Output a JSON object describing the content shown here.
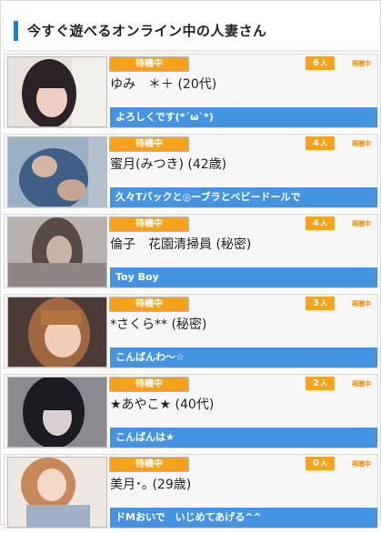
{
  "header": {
    "title": "今すぐ遊べるオンライン中の人妻さん",
    "accent": "#1f7fd6"
  },
  "colors": {
    "status_bg": "#f7a21b",
    "message_bg": "#4593e3",
    "viewing_text": "#f08a00"
  },
  "members": [
    {
      "status": "待機中",
      "count": "6",
      "count_unit": "人",
      "viewing_label": "視聴中",
      "name": "ゆみ　＊＋ (20代)",
      "message": "よろしくです(*´ω`*)"
    },
    {
      "status": "待機中",
      "count": "4",
      "count_unit": "人",
      "viewing_label": "視聴中",
      "name": "蜜月(みつき) (42歳)",
      "message": "久々Tバックと◎ーブラとベビードールで"
    },
    {
      "status": "待機中",
      "count": "4",
      "count_unit": "人",
      "viewing_label": "視聴中",
      "name": "倫子　花園清掃員 (秘密)",
      "message": "Toy Boy"
    },
    {
      "status": "待機中",
      "count": "3",
      "count_unit": "人",
      "viewing_label": "視聴中",
      "name": "*さくら** (秘密)",
      "message": "こんばんわ～☆"
    },
    {
      "status": "待機中",
      "count": "2",
      "count_unit": "人",
      "viewing_label": "視聴中",
      "name": "★あやこ★ (40代)",
      "message": "こんばんは★"
    },
    {
      "status": "待機中",
      "count": "0",
      "count_unit": "人",
      "viewing_label": "視聴中",
      "name": "美月･｡ (29歳)",
      "message": "ドMおいで　いじめてあげる^^"
    }
  ]
}
